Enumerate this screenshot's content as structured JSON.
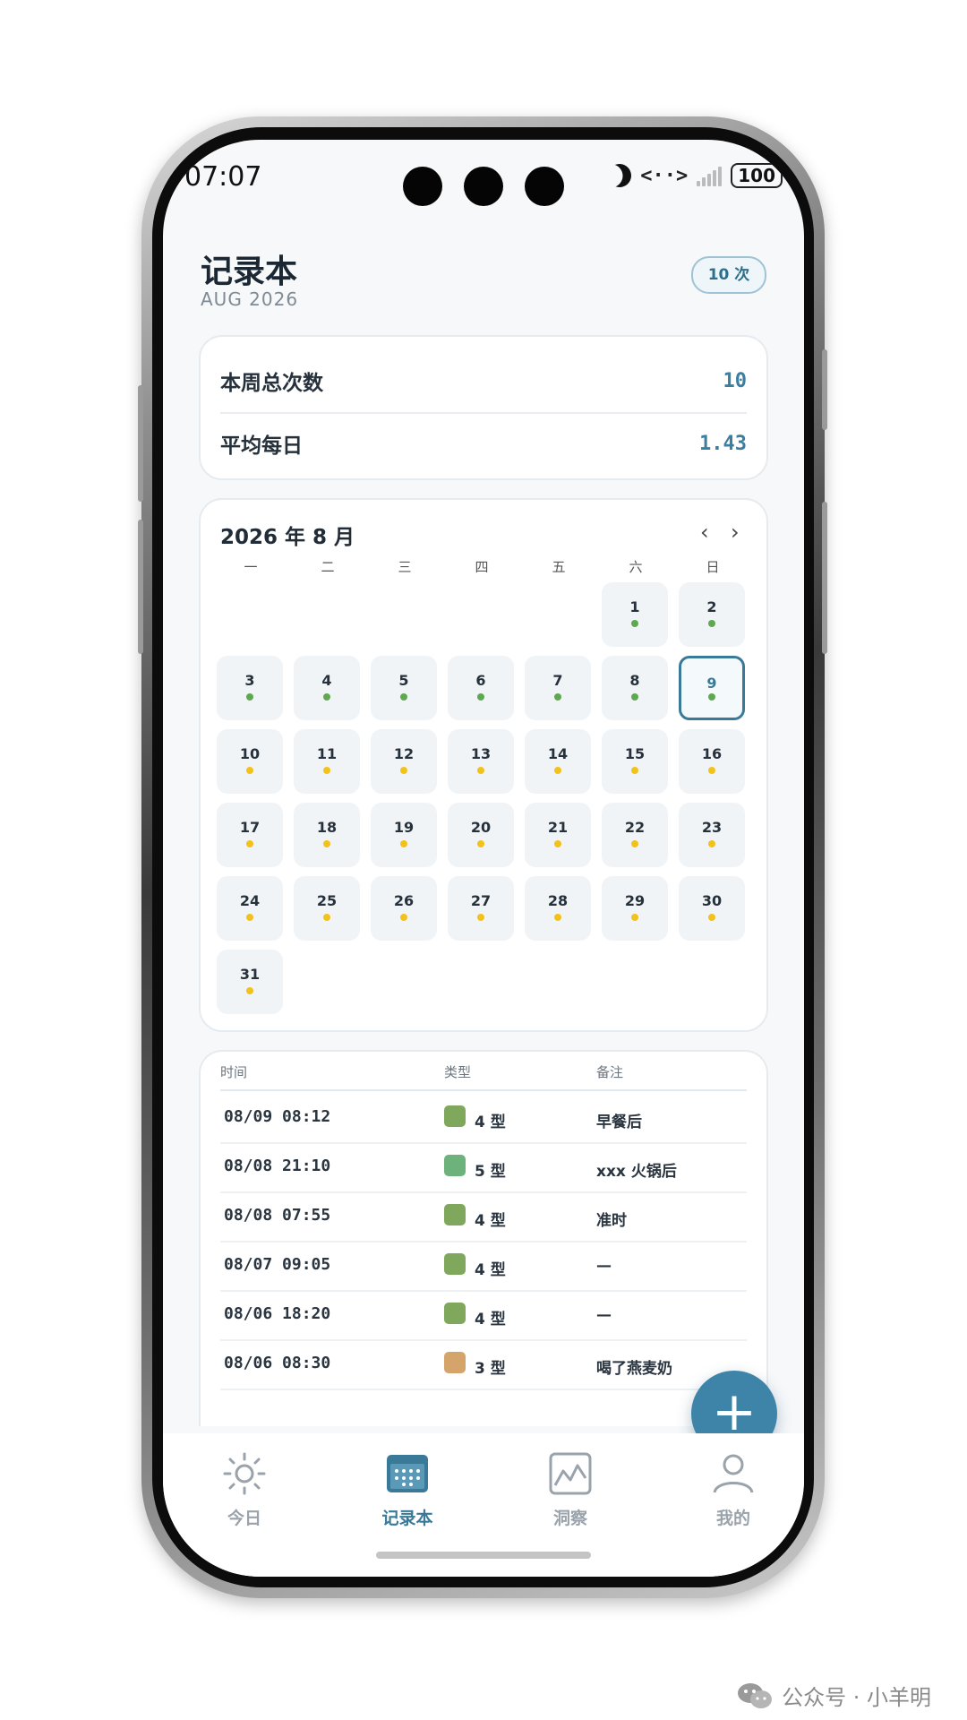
{
  "status": {
    "time": "07:07",
    "network": "<··>",
    "battery": "100"
  },
  "header": {
    "title": "记录本",
    "subtitle": "AUG 2026",
    "count_badge": "10 次"
  },
  "stats": [
    {
      "label": "本周总次数",
      "value": "10"
    },
    {
      "label": "平均每日",
      "value": "1.43"
    }
  ],
  "calendar": {
    "title": "2026 年 8 月",
    "prev": "‹",
    "next": "›",
    "weekdays": [
      "一",
      "二",
      "三",
      "四",
      "五",
      "六",
      "日"
    ],
    "today": "9",
    "days": [
      "1",
      "2",
      "3",
      "4",
      "5",
      "6",
      "7",
      "8",
      "9",
      "10",
      "11",
      "12",
      "13",
      "14",
      "15",
      "16",
      "17",
      "18",
      "19",
      "20",
      "21",
      "22",
      "23",
      "24",
      "25",
      "26",
      "27",
      "28",
      "29",
      "30",
      "31"
    ]
  },
  "colors": {
    "accent": "#3a7a98",
    "dot_green": "#5fa84f",
    "dot_yellow": "#f2c21b",
    "type4": "#7fa85c",
    "type5": "#6db27a",
    "type3": "#d4a46a"
  },
  "records": {
    "columns": [
      "时间",
      "类型",
      "备注"
    ],
    "rows": [
      {
        "time": "08/09 08:12",
        "type": "4 型",
        "note": "早餐后",
        "color": "#7fa85c"
      },
      {
        "time": "08/08 21:10",
        "type": "5 型",
        "note": "xxx 火锅后",
        "color": "#6db27a"
      },
      {
        "time": "08/08 07:55",
        "type": "4 型",
        "note": "准时",
        "color": "#7fa85c"
      },
      {
        "time": "08/07 09:05",
        "type": "4 型",
        "note": "—",
        "color": "#7fa85c"
      },
      {
        "time": "08/06 18:20",
        "type": "4 型",
        "note": "—",
        "color": "#7fa85c"
      },
      {
        "time": "08/06 08:30",
        "type": "3 型",
        "note": "喝了燕麦奶",
        "color": "#d4a46a"
      }
    ]
  },
  "fab": {
    "label": "+"
  },
  "tabs": [
    {
      "label": "今日",
      "icon": "sun-icon"
    },
    {
      "label": "记录本",
      "icon": "calendar-icon"
    },
    {
      "label": "洞察",
      "icon": "chart-icon"
    },
    {
      "label": "我的",
      "icon": "user-icon"
    }
  ],
  "watermark": {
    "text": "公众号 · 小羊明"
  }
}
